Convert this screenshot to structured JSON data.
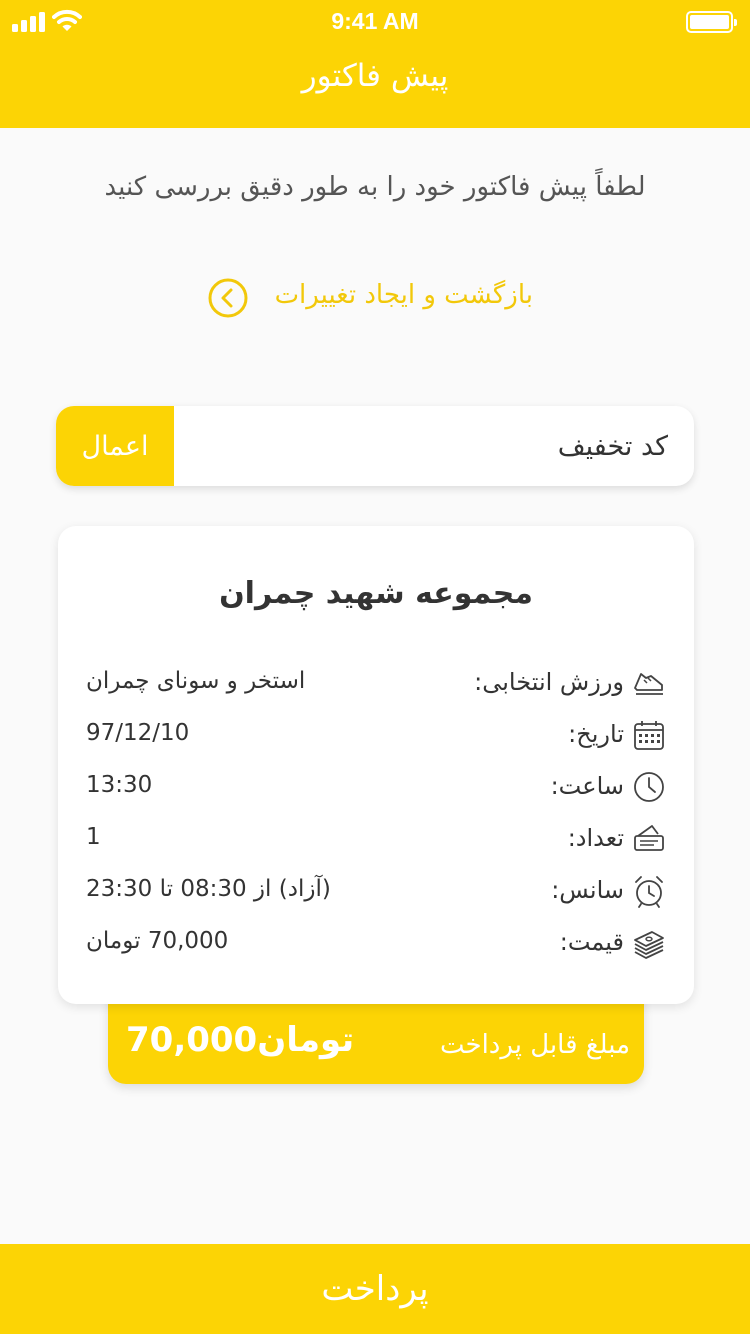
{
  "status_bar": {
    "time": "9:41 AM"
  },
  "header": {
    "title": "پیش فاکتور"
  },
  "instruction": "لطفاً پیش فاکتور خود را به طور دقیق بررسی کنید",
  "back_link": {
    "label": "بازگشت و ایجاد تغییرات",
    "icon": "chevron-left-circle-icon"
  },
  "discount": {
    "placeholder": "کد تخفیف",
    "value": "",
    "apply_label": "اعمال"
  },
  "invoice": {
    "venue": "مجموعه شهید چمران",
    "rows": [
      {
        "icon": "sneaker-icon",
        "label": "ورزش انتخابی:",
        "value": "استخر و سونای چمران"
      },
      {
        "icon": "calendar-icon",
        "label": "تاریخ:",
        "value": "97/12/10"
      },
      {
        "icon": "clock-icon",
        "label": "ساعت:",
        "value": "13:30"
      },
      {
        "icon": "ticket-icon",
        "label": "تعداد:",
        "value": "1"
      },
      {
        "icon": "alarm-clock-icon",
        "label": "سانس:",
        "value": "(آزاد) از 08:30 تا 23:30"
      },
      {
        "icon": "cash-stack-icon",
        "label": "قیمت:",
        "value": "70,000 تومان"
      }
    ]
  },
  "total": {
    "label": "مبلغ قابل پرداخت",
    "amount": "70,000تومان"
  },
  "pay_button": {
    "label": "پرداخت"
  },
  "colors": {
    "accent": "#fcd405",
    "link": "#f2c80a",
    "background": "#fafafa",
    "text": "#333333"
  }
}
